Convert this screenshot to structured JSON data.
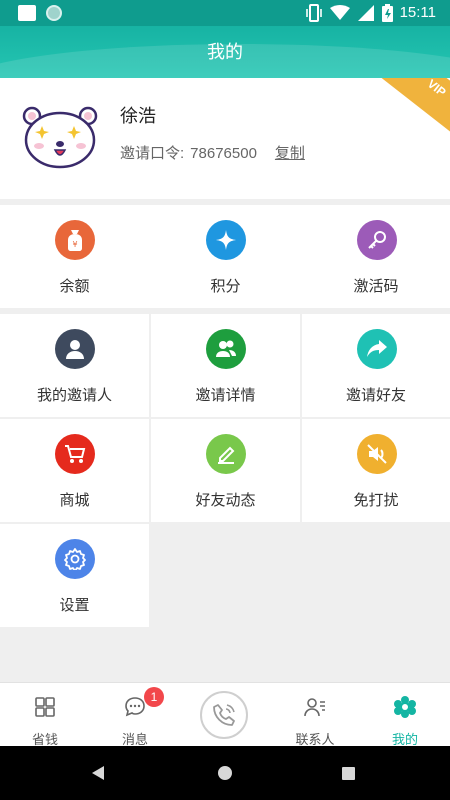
{
  "status_bar": {
    "time": "15:11"
  },
  "header": {
    "title": "我的"
  },
  "profile": {
    "name": "徐浩",
    "invite_label": "邀请口令:",
    "invite_code": "78676500",
    "copy_label": "复制",
    "vip_badge": "VIP"
  },
  "grid1": [
    {
      "label": "余额",
      "icon": "money-bag-icon",
      "color": "#e8673a"
    },
    {
      "label": "积分",
      "icon": "diamond-star-icon",
      "color": "#1f97e0"
    },
    {
      "label": "激活码",
      "icon": "key-icon",
      "color": "#9c5bb8"
    }
  ],
  "grid2": [
    {
      "label": "我的邀请人",
      "icon": "person-icon",
      "color": "#3e4a5e"
    },
    {
      "label": "邀请详情",
      "icon": "group-icon",
      "color": "#1e9e3e"
    },
    {
      "label": "邀请好友",
      "icon": "share-arrow-icon",
      "color": "#1fc1b4"
    },
    {
      "label": "商城",
      "icon": "cart-icon",
      "color": "#e52a1d"
    },
    {
      "label": "好友动态",
      "icon": "edit-pen-icon",
      "color": "#79c84b"
    },
    {
      "label": "免打扰",
      "icon": "mute-speaker-icon",
      "color": "#f0b02f"
    },
    {
      "label": "设置",
      "icon": "gear-icon",
      "color": "#4d84e8"
    }
  ],
  "tabs": [
    {
      "label": "省钱",
      "icon": "grid-icon"
    },
    {
      "label": "消息",
      "icon": "chat-bubble-icon",
      "badge": "1"
    },
    {
      "label": "",
      "icon": "phone-call-icon"
    },
    {
      "label": "联系人",
      "icon": "contacts-icon"
    },
    {
      "label": "我的",
      "icon": "flower-icon",
      "active": true
    }
  ],
  "colors": {
    "accent": "#14b5a3",
    "vip": "#f0b33d",
    "badge": "#f2474b"
  }
}
